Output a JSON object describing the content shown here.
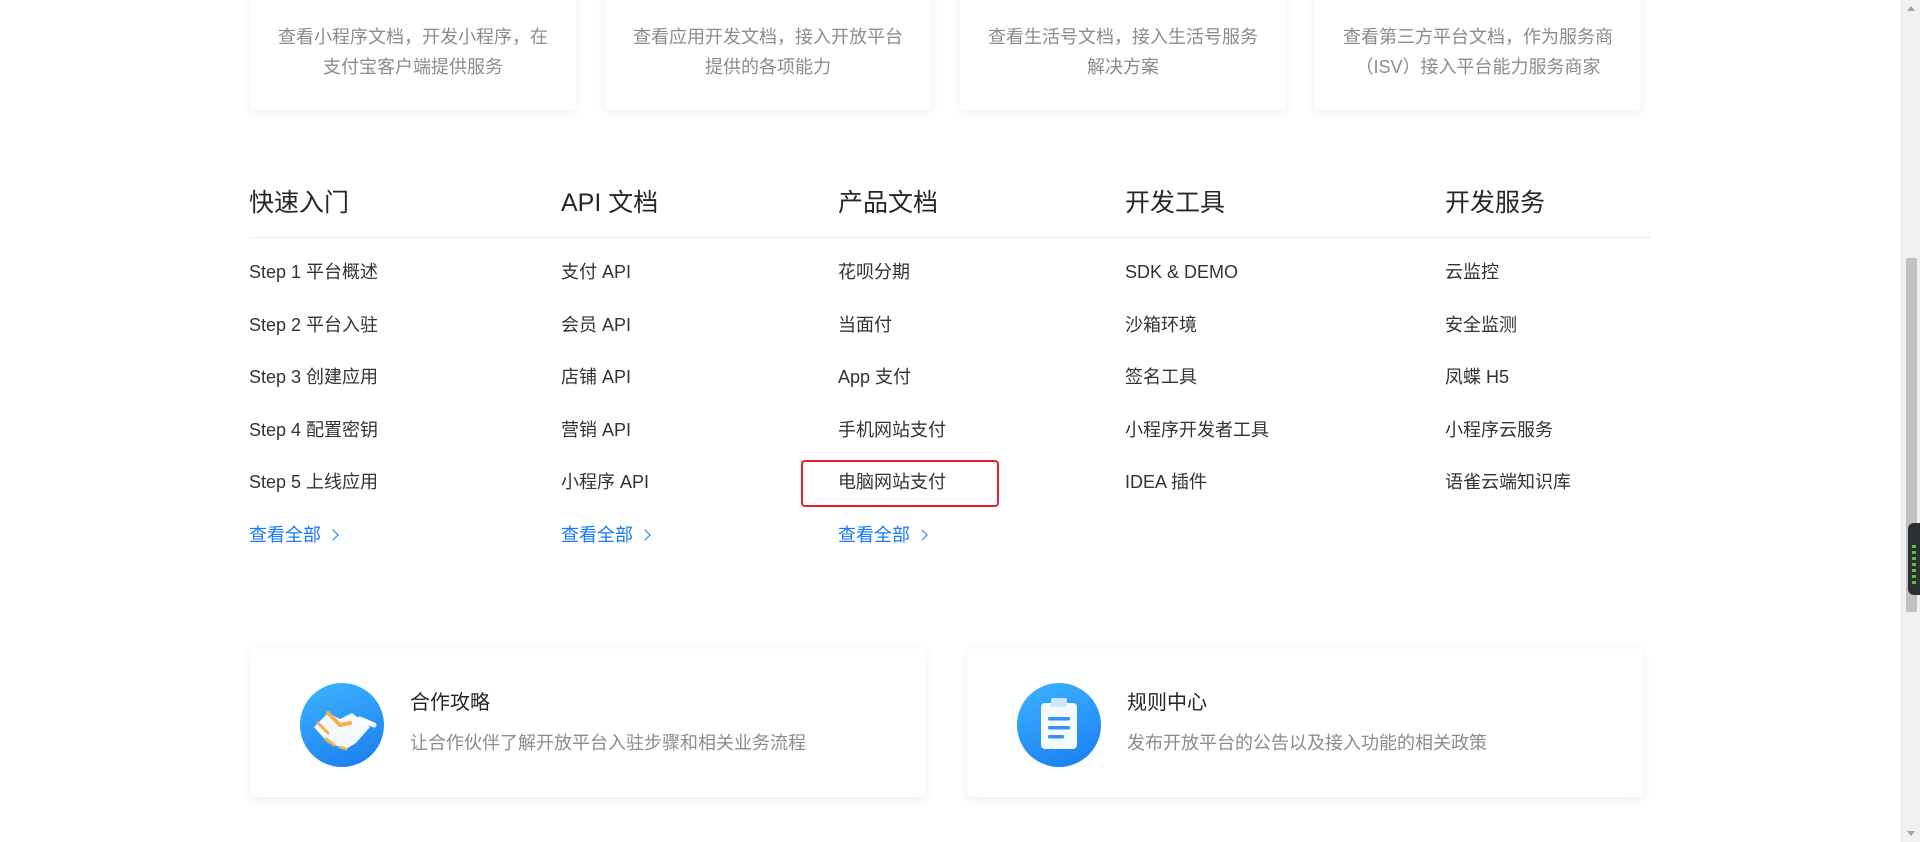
{
  "top_cards": [
    {
      "desc": "查看小程序文档，开发小程序，在支付宝客户端提供服务"
    },
    {
      "desc": "查看应用开发文档，接入开放平台提供的各项能力"
    },
    {
      "desc": "查看生活号文档，接入生活号服务解决方案"
    },
    {
      "desc": "查看第三方平台文档，作为服务商（ISV）接入平台能力服务商家"
    }
  ],
  "columns": [
    {
      "title": "快速入门",
      "items": [
        "Step 1 平台概述",
        "Step 2 平台入驻",
        "Step 3 创建应用",
        "Step 4 配置密钥",
        "Step 5 上线应用"
      ],
      "see_all": "查看全部"
    },
    {
      "title": "API 文档",
      "items": [
        "支付 API",
        "会员 API",
        "店铺 API",
        "营销 API",
        "小程序 API"
      ],
      "see_all": "查看全部"
    },
    {
      "title": "产品文档",
      "items": [
        "花呗分期",
        "当面付",
        "App 支付",
        "手机网站支付",
        "电脑网站支付"
      ],
      "see_all": "查看全部"
    },
    {
      "title": "开发工具",
      "items": [
        "SDK & DEMO",
        "沙箱环境",
        "签名工具",
        "小程序开发者工具",
        "IDEA 插件"
      ]
    },
    {
      "title": "开发服务",
      "items": [
        "云监控",
        "安全监测",
        "凤蝶 H5",
        "小程序云服务",
        "语雀云端知识库"
      ]
    }
  ],
  "bottom_cards": [
    {
      "title": "合作攻略",
      "desc": "让合作伙伴了解开放平台入驻步骤和相关业务流程",
      "icon": "handshake-icon"
    },
    {
      "title": "规则中心",
      "desc": "发布开放平台的公告以及接入功能的相关政策",
      "icon": "clipboard-icon"
    }
  ],
  "colors": {
    "link": "#1677ff",
    "highlight": "#e8202b",
    "icon_gradient_start": "#3cb4ff",
    "icon_gradient_end": "#1a7cf0"
  }
}
